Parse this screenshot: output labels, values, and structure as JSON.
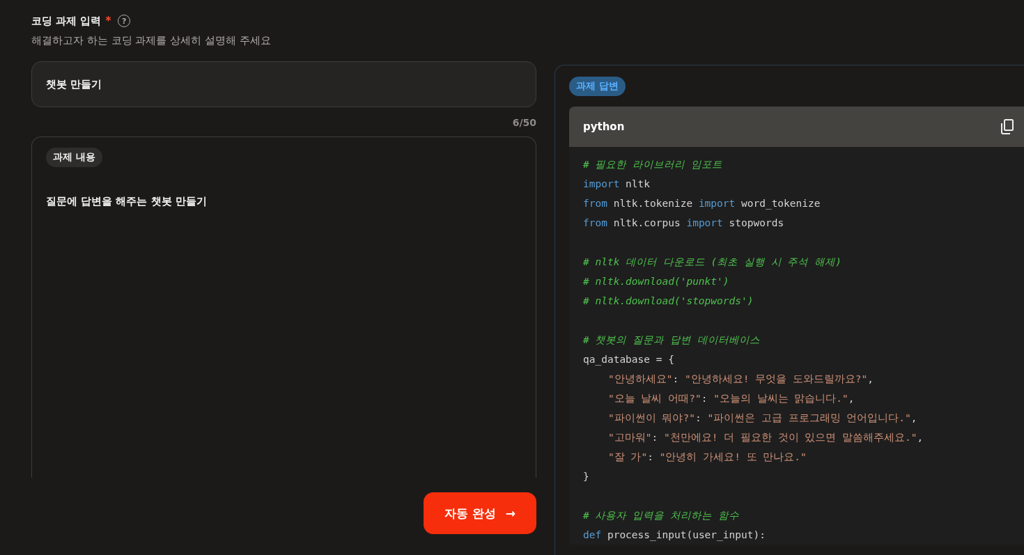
{
  "form": {
    "label": "코딩 과제 입력",
    "required_mark": "*",
    "help_icon": "?",
    "description": "해결하고자 하는 코딩 과제를 상세히 설명해 주세요",
    "title_field": {
      "value": "챗봇 만들기",
      "counter": "6/50"
    },
    "content_field": {
      "tag": "과제 내용",
      "value": "질문에 답변을 해주는 챗봇 만들기"
    },
    "submit_button": {
      "label": "자동 완성",
      "arrow": "→"
    }
  },
  "answer": {
    "tag": "과제 답변",
    "language": "python",
    "code_lines": [
      {
        "kind": "code",
        "tokens": [
          {
            "kind": "comment",
            "text": "# 필요한 라이브러리 임포트"
          }
        ]
      },
      {
        "kind": "code",
        "tokens": [
          {
            "kind": "keyword",
            "text": "import"
          },
          {
            "kind": "plain",
            "text": " nltk"
          }
        ]
      },
      {
        "kind": "code",
        "tokens": [
          {
            "kind": "keyword",
            "text": "from"
          },
          {
            "kind": "plain",
            "text": " nltk.tokenize "
          },
          {
            "kind": "keyword",
            "text": "import"
          },
          {
            "kind": "plain",
            "text": " word_tokenize"
          }
        ]
      },
      {
        "kind": "code",
        "tokens": [
          {
            "kind": "keyword",
            "text": "from"
          },
          {
            "kind": "plain",
            "text": " nltk.corpus "
          },
          {
            "kind": "keyword",
            "text": "import"
          },
          {
            "kind": "plain",
            "text": " stopwords"
          }
        ]
      },
      {
        "kind": "blank"
      },
      {
        "kind": "code",
        "tokens": [
          {
            "kind": "comment",
            "text": "# nltk 데이터 다운로드 (최초 실행 시 주석 해제)"
          }
        ]
      },
      {
        "kind": "code",
        "tokens": [
          {
            "kind": "comment",
            "text": "# nltk.download('punkt')"
          }
        ]
      },
      {
        "kind": "code",
        "tokens": [
          {
            "kind": "comment",
            "text": "# nltk.download('stopwords')"
          }
        ]
      },
      {
        "kind": "blank"
      },
      {
        "kind": "code",
        "tokens": [
          {
            "kind": "comment",
            "text": "# 챗봇의 질문과 답변 데이터베이스"
          }
        ]
      },
      {
        "kind": "code",
        "tokens": [
          {
            "kind": "plain",
            "text": "qa_database = {"
          }
        ]
      },
      {
        "kind": "indented",
        "tokens": [
          {
            "kind": "string",
            "text": "\"안녕하세요\""
          },
          {
            "kind": "plain",
            "text": ": "
          },
          {
            "kind": "string",
            "text": "\"안녕하세요! 무엇을 도와드릴까요?\""
          },
          {
            "kind": "plain",
            "text": ","
          }
        ]
      },
      {
        "kind": "indented",
        "tokens": [
          {
            "kind": "string",
            "text": "\"오늘 날씨 어때?\""
          },
          {
            "kind": "plain",
            "text": ": "
          },
          {
            "kind": "string",
            "text": "\"오늘의 날씨는 맑습니다.\""
          },
          {
            "kind": "plain",
            "text": ","
          }
        ]
      },
      {
        "kind": "indented",
        "tokens": [
          {
            "kind": "string",
            "text": "\"파이썬이 뭐야?\""
          },
          {
            "kind": "plain",
            "text": ": "
          },
          {
            "kind": "string",
            "text": "\"파이썬은 고급 프로그래밍 언어입니다.\""
          },
          {
            "kind": "plain",
            "text": ","
          }
        ]
      },
      {
        "kind": "indented",
        "tokens": [
          {
            "kind": "string",
            "text": "\"고마워\""
          },
          {
            "kind": "plain",
            "text": ": "
          },
          {
            "kind": "string",
            "text": "\"천만에요! 더 필요한 것이 있으면 말씀해주세요.\""
          },
          {
            "kind": "plain",
            "text": ","
          }
        ]
      },
      {
        "kind": "indented",
        "tokens": [
          {
            "kind": "string",
            "text": "\"잘 가\""
          },
          {
            "kind": "plain",
            "text": ": "
          },
          {
            "kind": "string",
            "text": "\"안녕히 가세요! 또 만나요.\""
          }
        ]
      },
      {
        "kind": "code",
        "tokens": [
          {
            "kind": "plain",
            "text": "}"
          }
        ]
      },
      {
        "kind": "blank"
      },
      {
        "kind": "code",
        "tokens": [
          {
            "kind": "comment",
            "text": "# 사용자 입력을 처리하는 함수"
          }
        ]
      },
      {
        "kind": "code",
        "tokens": [
          {
            "kind": "keyword",
            "text": "def"
          },
          {
            "kind": "plain",
            "text": " process_input(user_input):"
          }
        ]
      }
    ]
  }
}
